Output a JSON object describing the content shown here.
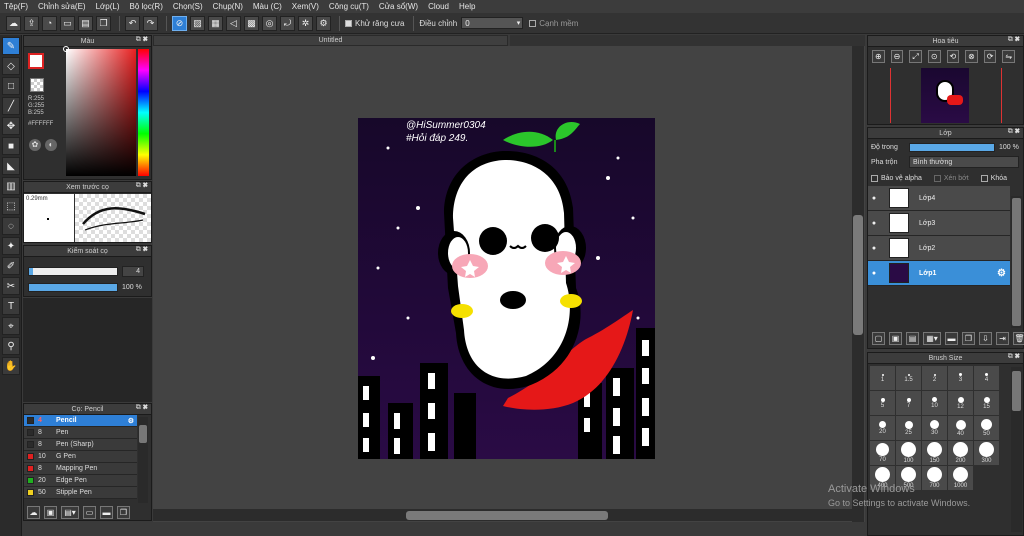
{
  "menu": [
    "Tệp(F)",
    "Chỉnh sửa(E)",
    "Lớp(L)",
    "Bộ lọc(R)",
    "Chọn(S)",
    "Chụp(N)",
    "Màu (C)",
    "Xem(V)",
    "Công cụ(T)",
    "Cửa sổ(W)",
    "Cloud",
    "Help"
  ],
  "toolbar": {
    "antialias_label": "Khử răng cưa",
    "adjust_label": "Điều chỉnh",
    "adjust_value": "0",
    "clipping_label": "Cạnh mềm"
  },
  "color_panel": {
    "title": "Màu",
    "r": "R:255",
    "g": "G:255",
    "b": "B:255",
    "hex": "#FFFFFF"
  },
  "preview_panel": {
    "title": "Xem trước cọ",
    "size": "0.29mm"
  },
  "brush_control": {
    "title": "Kiểm soát cọ",
    "size_value": "4",
    "opacity_value": "100 %"
  },
  "brush_panel": {
    "title": "Cọ: Pencil",
    "brushes": [
      {
        "num": "4",
        "name": "Pencil",
        "color": "#2b2b2b"
      },
      {
        "num": "8",
        "name": "Pen",
        "color": "#2b2b2b"
      },
      {
        "num": "8",
        "name": "Pen (Sharp)",
        "color": "#2b2b2b"
      },
      {
        "num": "10",
        "name": "G Pen",
        "color": "#e02020"
      },
      {
        "num": "8",
        "name": "Mapping Pen",
        "color": "#e02020"
      },
      {
        "num": "20",
        "name": "Edge Pen",
        "color": "#20b020"
      },
      {
        "num": "50",
        "name": "Stipple Pen",
        "color": "#f0d020"
      }
    ]
  },
  "document": {
    "title": "Untitled",
    "caption_line1": "@HiSummer0304",
    "caption_line2": "#Hỏi đáp 249."
  },
  "navigator": {
    "title": "Hoa tiêu"
  },
  "layers_panel": {
    "title": "Lớp",
    "opacity_label": "Độ trong",
    "opacity_value": "100 %",
    "opacity_level": 1.0,
    "blend_label": "Pha trộn",
    "blend_value": "Bình thường",
    "protect_alpha": "Bảo vệ alpha",
    "clipping": "Xén bớt",
    "lock": "Khóa",
    "layers": [
      "Lớp4",
      "Lớp3",
      "Lớp2",
      "Lớp1"
    ]
  },
  "brush_size": {
    "title": "Brush Size",
    "sizes": [
      "1",
      "1.5",
      "2",
      "3",
      "4",
      "5",
      "7",
      "10",
      "12",
      "15",
      "20",
      "25",
      "30",
      "40",
      "50",
      "70",
      "100",
      "150",
      "200",
      "300",
      "400",
      "500",
      "700",
      "1000"
    ]
  },
  "watermark": {
    "line1": "Activate Windows",
    "line2": "Go to Settings to activate Windows."
  }
}
